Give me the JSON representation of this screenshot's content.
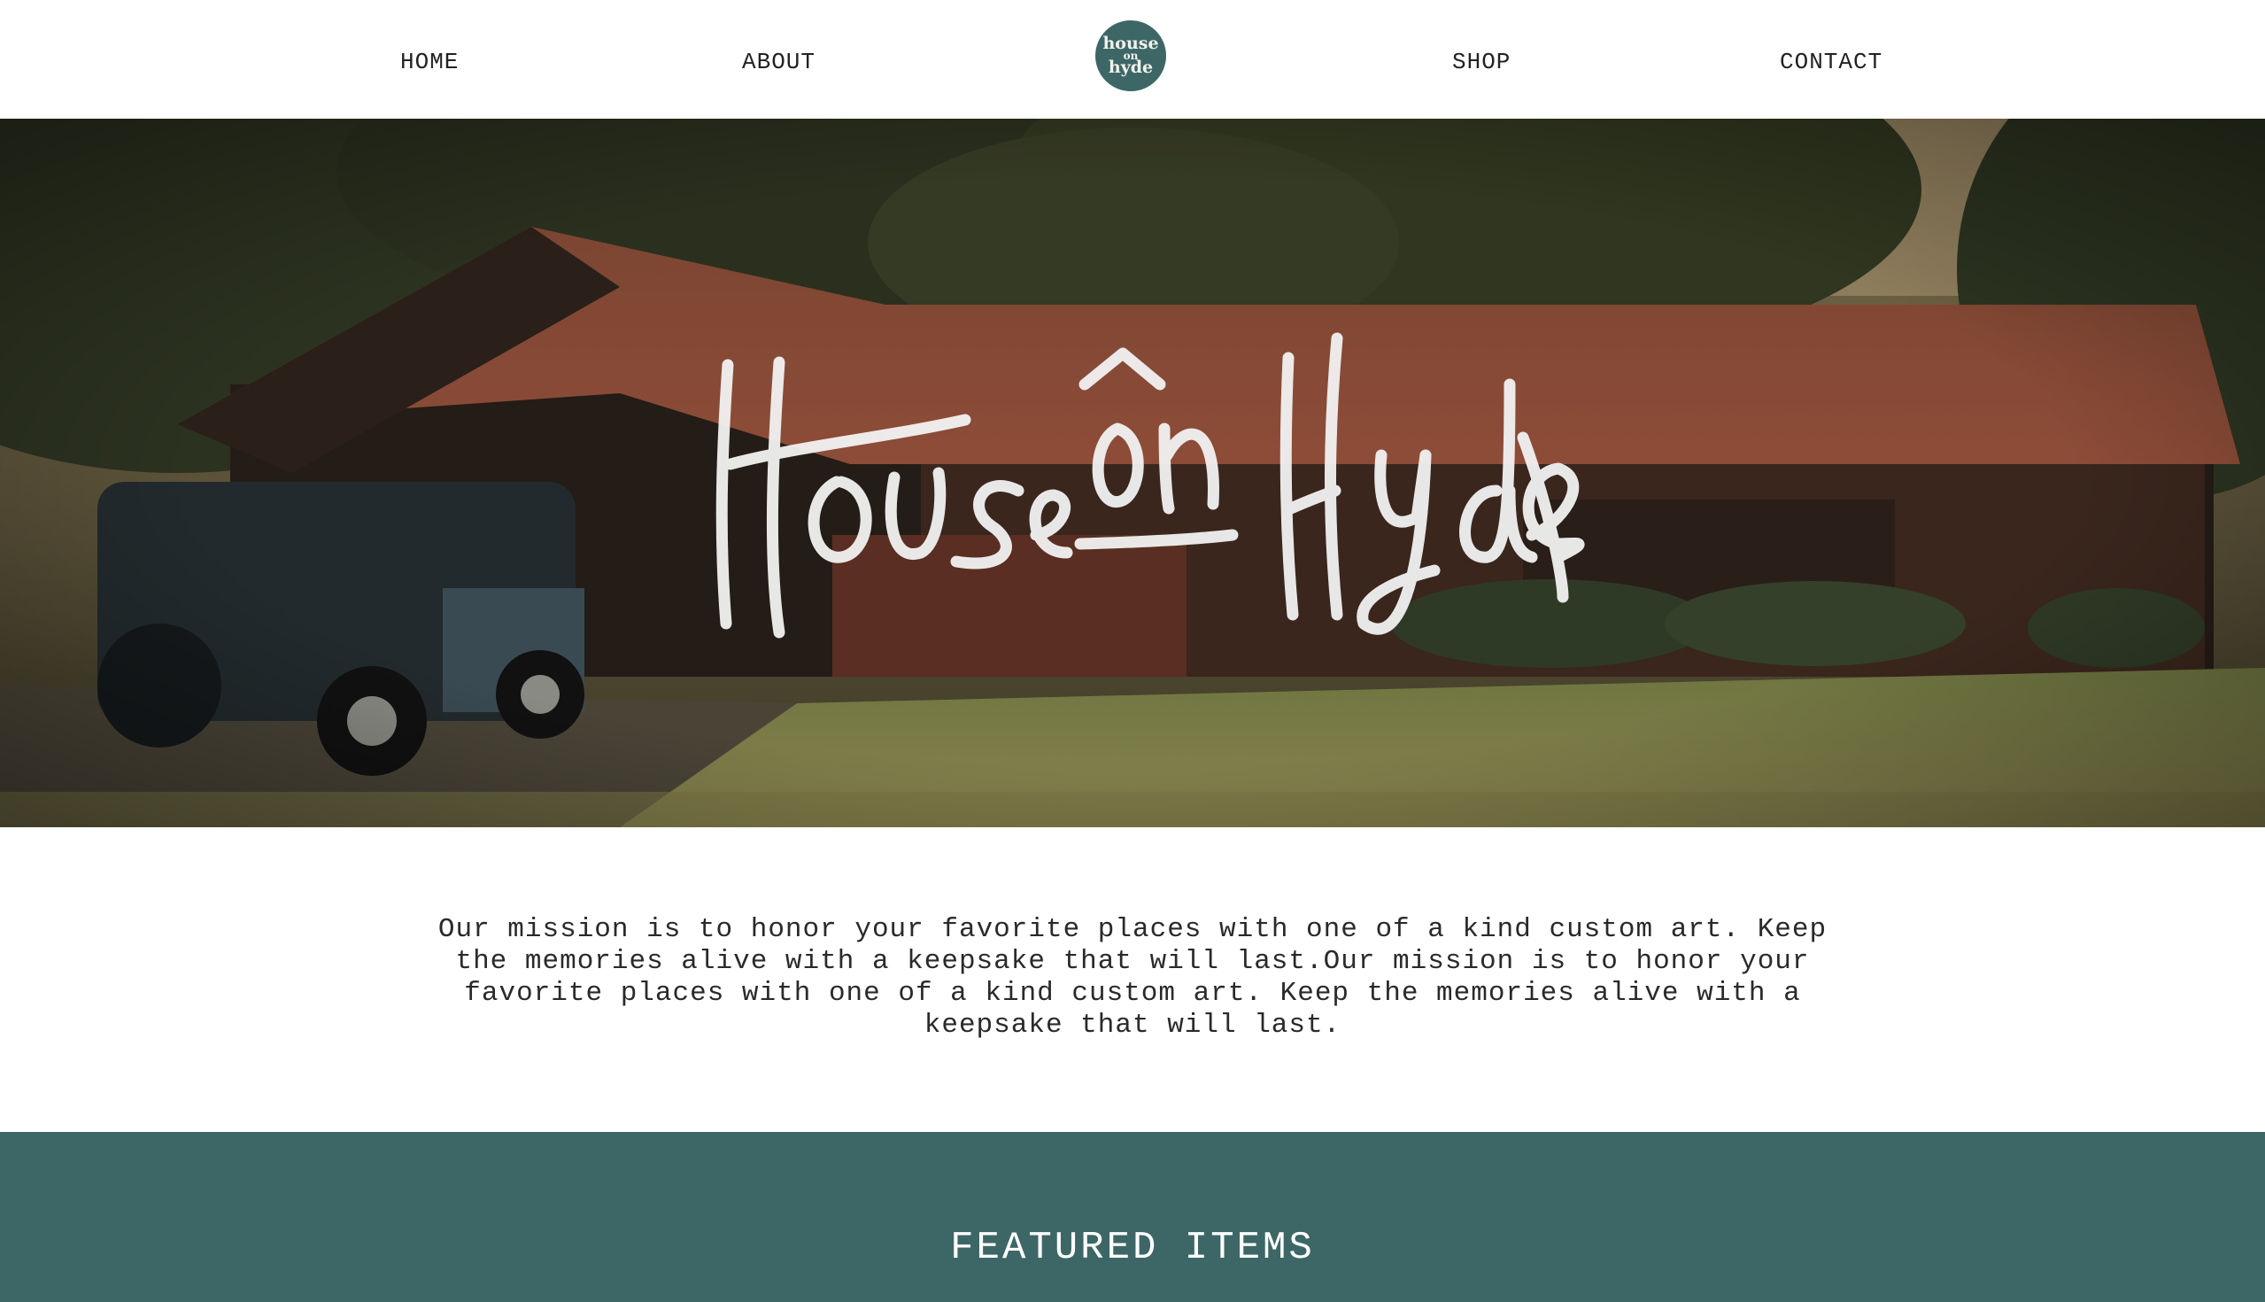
{
  "nav": {
    "home": "HOME",
    "about": "ABOUT",
    "shop": "SHOP",
    "contact": "CONTACT",
    "logo_line1": "house",
    "logo_line2": "on",
    "logo_line3": "hyde"
  },
  "hero": {
    "script_title": "House on Hyde"
  },
  "mission": {
    "text": "Our mission is to honor your favorite places with one of a kind custom art. Keep the memories alive with a keepsake that will last.Our mission is to honor your favorite places with one of a kind custom art. Keep the memories alive with a keepsake that will last."
  },
  "featured": {
    "title": "FEATURED ITEMS"
  },
  "colors": {
    "brand_teal": "#3d6766",
    "nav_bg": "#ffffff",
    "text": "#222222"
  }
}
